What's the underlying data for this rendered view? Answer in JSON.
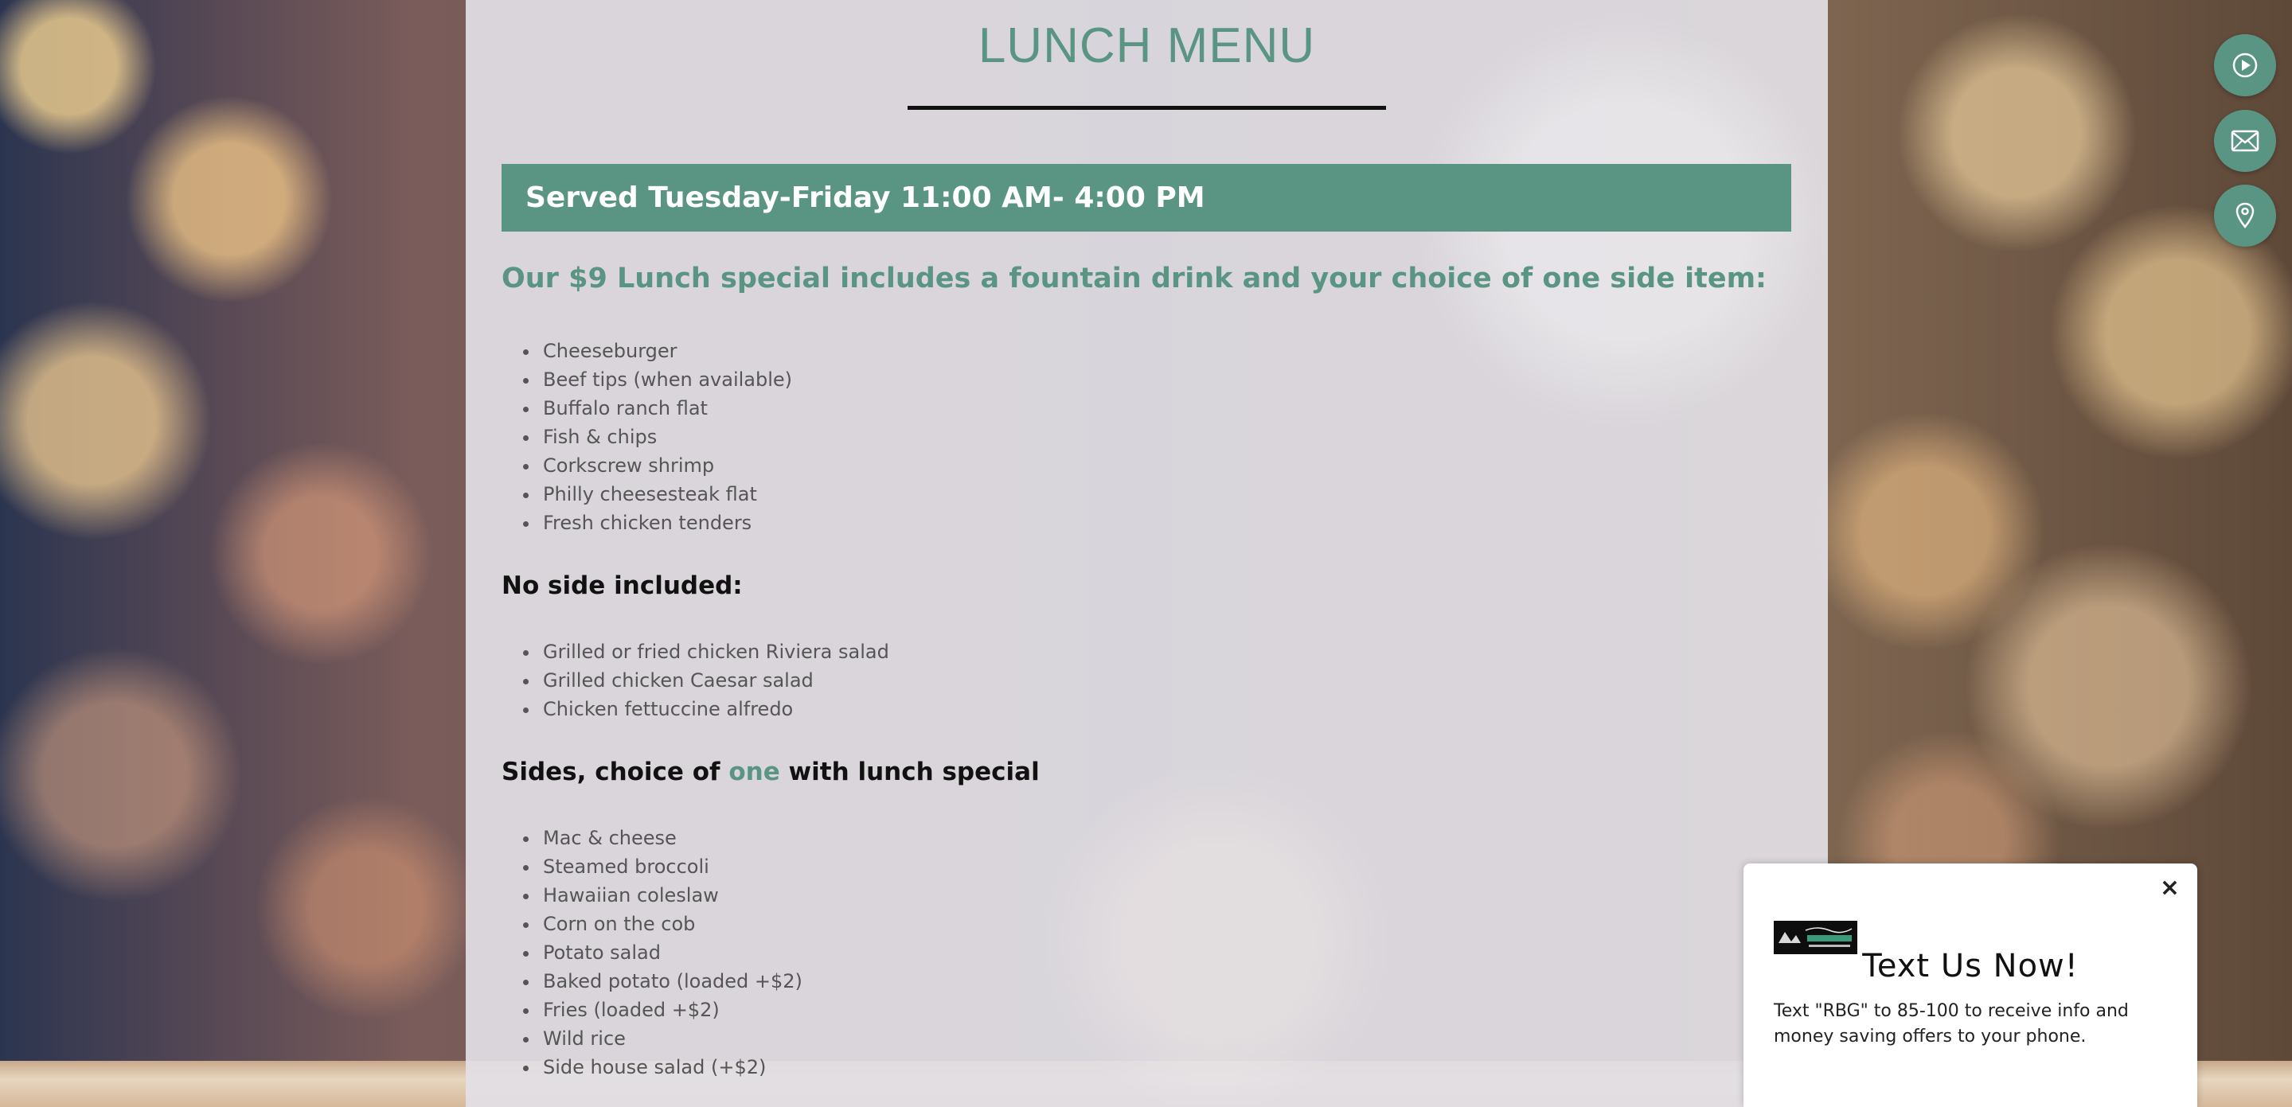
{
  "page": {
    "title": "LUNCH MENU",
    "served_banner": "Served Tuesday-Friday 11:00 AM- 4:00 PM"
  },
  "lunch_special": {
    "heading": "Our $9 Lunch special includes a fountain drink and your choice of one side item:",
    "items": [
      "Cheeseburger",
      "Beef tips (when available)",
      "Buffalo ranch flat",
      "Fish & chips",
      "Corkscrew shrimp",
      "Philly cheesesteak flat",
      "Fresh chicken tenders"
    ]
  },
  "no_side": {
    "heading": "No side included:",
    "items": [
      "Grilled or fried chicken Riviera salad",
      "Grilled chicken Caesar salad",
      "Chicken fettuccine alfredo"
    ]
  },
  "sides": {
    "heading_before": "Sides, choice of ",
    "heading_accent": "one",
    "heading_after": " with lunch special",
    "items": [
      "Mac & cheese",
      "Steamed broccoli",
      "Hawaiian coleslaw",
      "Corn on the cob",
      "Potato salad",
      "Baked potato (loaded +$2)",
      "Fries (loaded +$2)",
      "Wild rice",
      "Side house salad (+$2)"
    ]
  },
  "side_buttons": {
    "icons": [
      "play-icon",
      "mail-icon",
      "location-pin-icon"
    ]
  },
  "popup": {
    "close": "×",
    "title": "Text Us Now!",
    "body": "Text \"RBG\" to 85-100 to receive info and money saving offers to your phone."
  },
  "colors": {
    "accent": "#5a9583",
    "text": "#555555",
    "heading_dark": "#111111"
  }
}
